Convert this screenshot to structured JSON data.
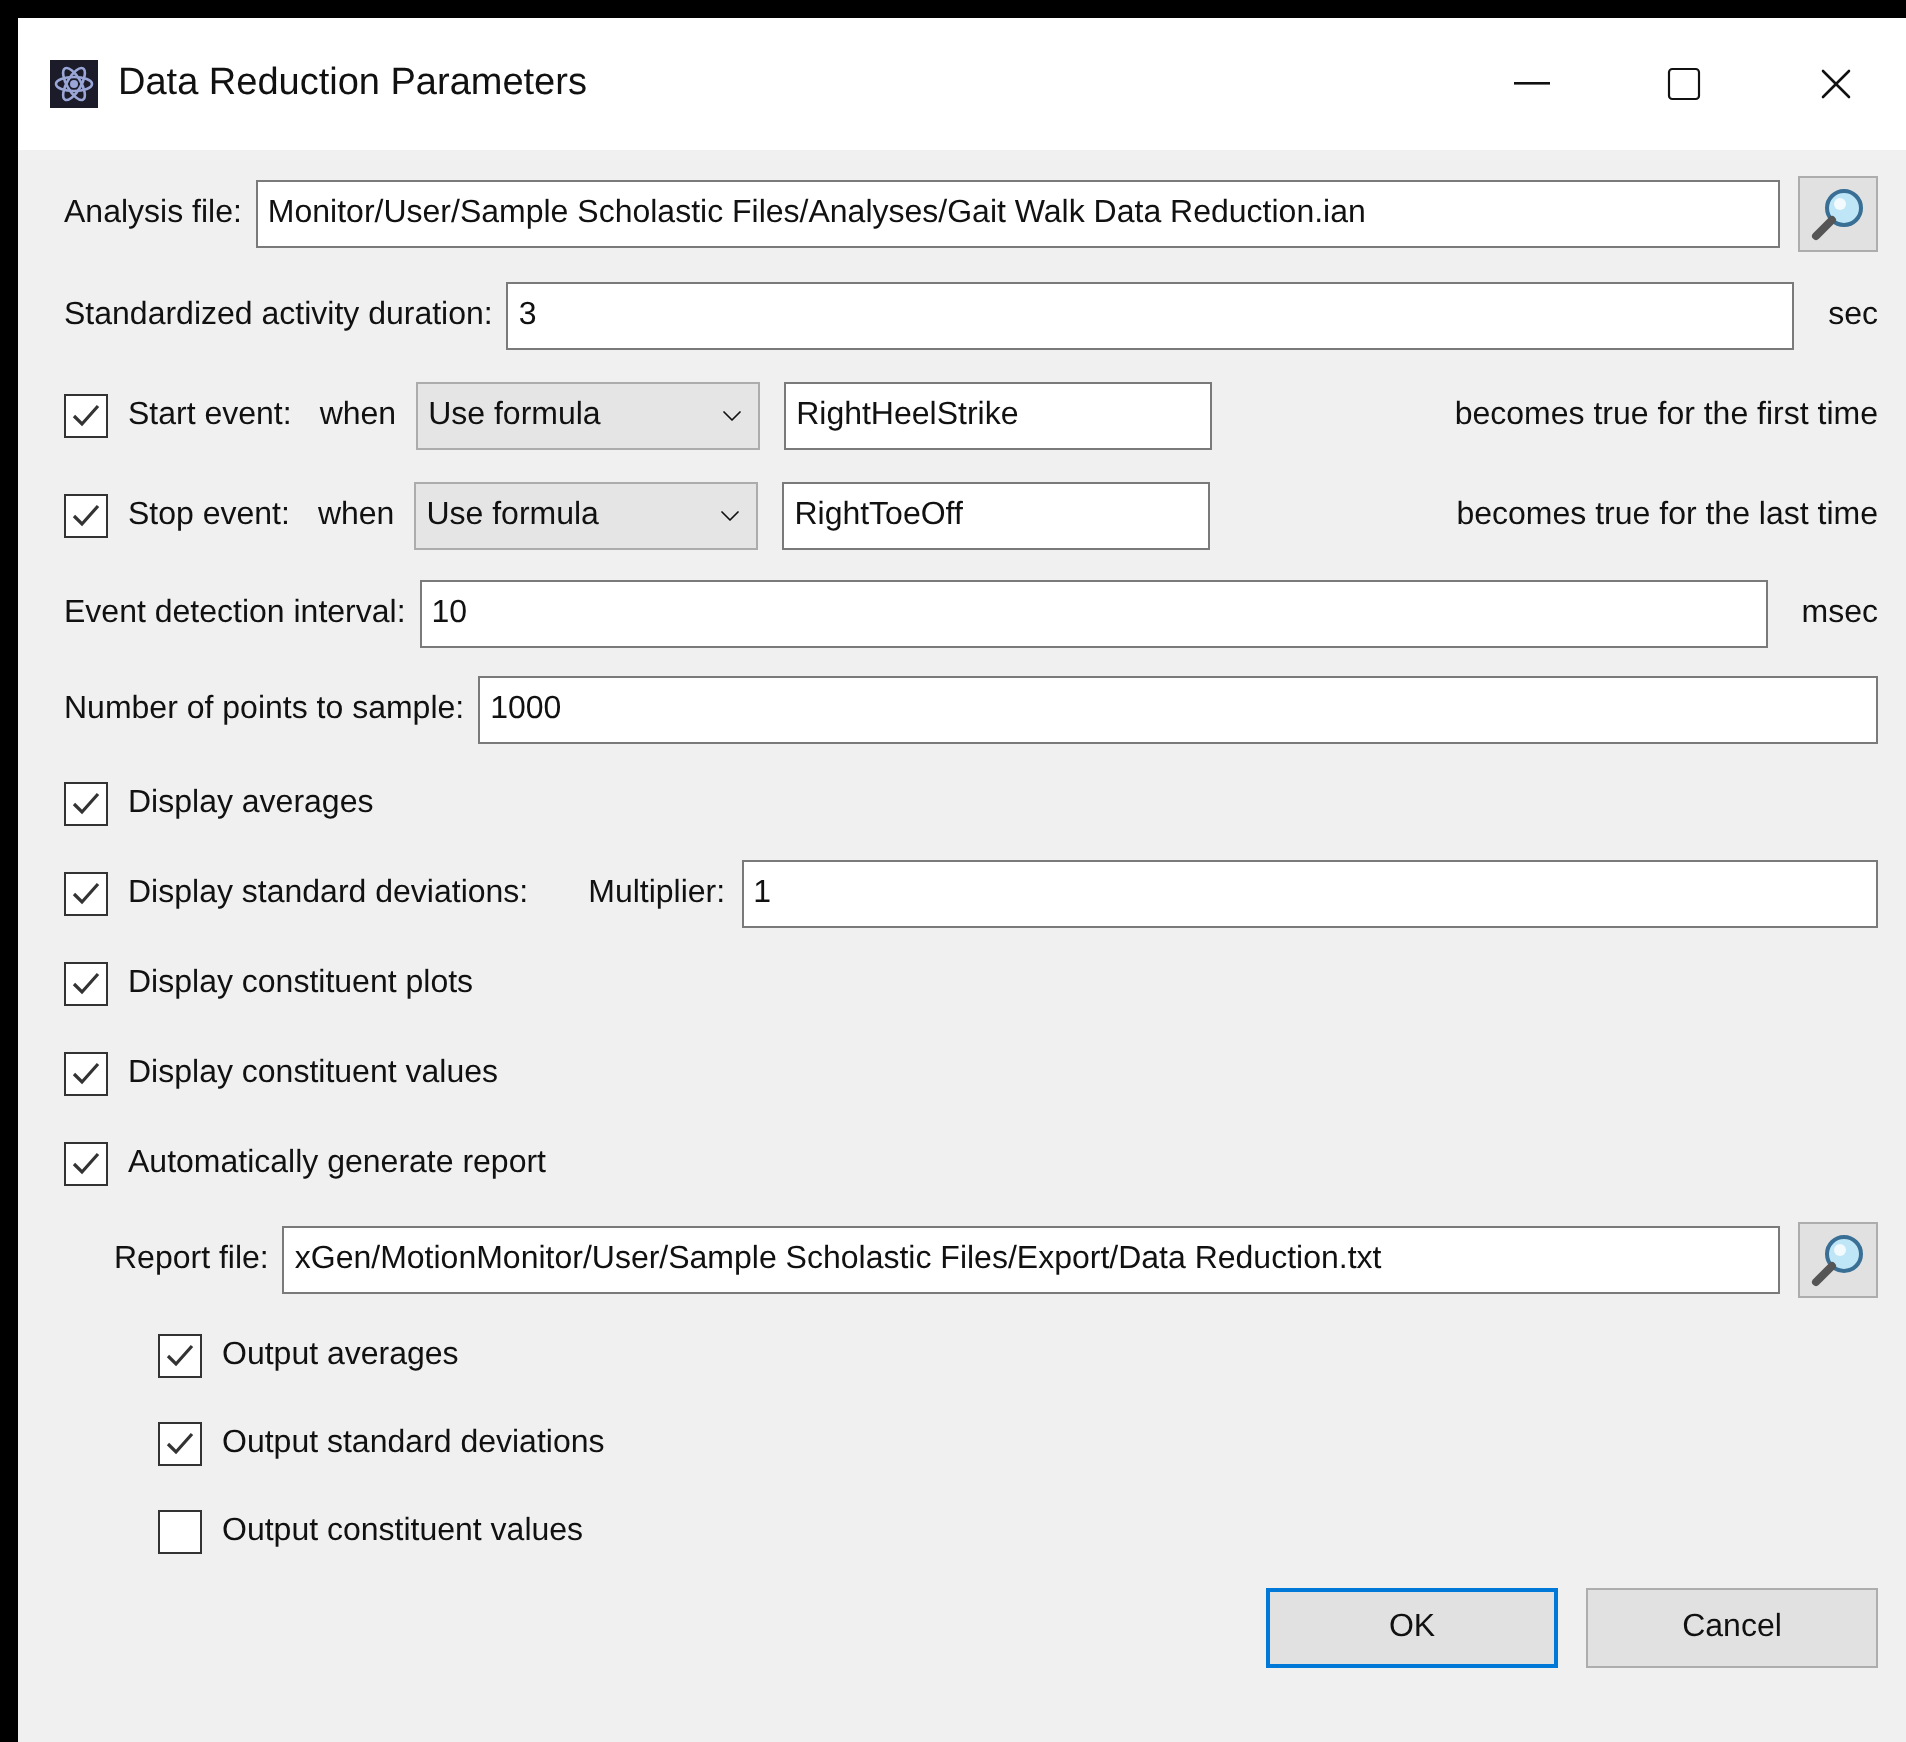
{
  "window": {
    "title": "Data Reduction Parameters"
  },
  "analysis_file": {
    "label": "Analysis file:",
    "value": "Monitor/User/Sample Scholastic Files/Analyses/Gait Walk Data Reduction.ian"
  },
  "duration": {
    "label": "Standardized activity duration:",
    "value": "3",
    "unit": "sec"
  },
  "events": [
    {
      "checked": true,
      "label": "Start event:",
      "when": "when",
      "mode": "Use formula",
      "formula": "RightHeelStrike",
      "suffix": "becomes true for the first time"
    },
    {
      "checked": true,
      "label": "Stop event:",
      "when": "when",
      "mode": "Use formula",
      "formula": "RightToeOff",
      "suffix": "becomes true for the last time"
    }
  ],
  "interval": {
    "label": "Event detection interval:",
    "value": "10",
    "unit": "msec"
  },
  "points": {
    "label": "Number of points to sample:",
    "value": "1000"
  },
  "options": [
    {
      "label": "Display averages",
      "checked": true
    },
    {
      "label": "Display standard deviations:",
      "checked": true,
      "multiplier": {
        "label": "Multiplier:",
        "value": "1"
      }
    },
    {
      "label": "Display constituent plots",
      "checked": true
    },
    {
      "label": "Display constituent values",
      "checked": true
    },
    {
      "label": "Automatically generate report",
      "checked": true
    }
  ],
  "report_file": {
    "label": "Report file:",
    "value": "xGen/MotionMonitor/User/Sample Scholastic Files/Export/Data Reduction.txt"
  },
  "outputs": [
    {
      "label": "Output averages",
      "checked": true
    },
    {
      "label": "Output standard deviations",
      "checked": true
    },
    {
      "label": "Output constituent values",
      "checked": false
    }
  ],
  "buttons": [
    {
      "label": "OK",
      "default": true
    },
    {
      "label": "Cancel",
      "default": false
    }
  ]
}
